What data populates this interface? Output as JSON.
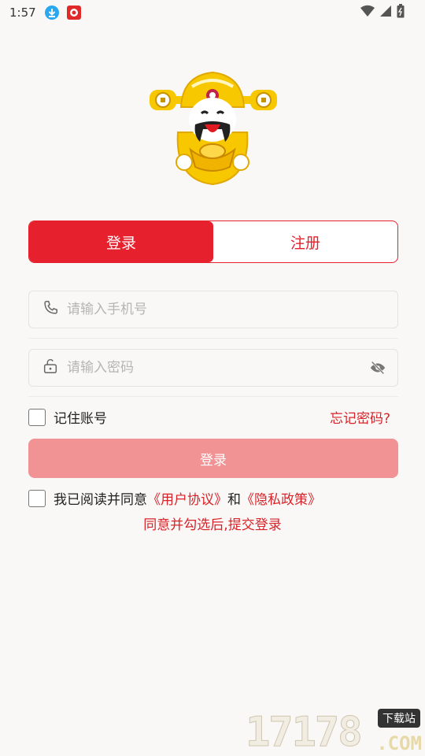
{
  "status_bar": {
    "time": "1:57"
  },
  "tabs": [
    {
      "label": "登录",
      "active": true
    },
    {
      "label": "注册",
      "active": false
    }
  ],
  "phone_field": {
    "placeholder": "请输入手机号",
    "value": ""
  },
  "password_field": {
    "placeholder": "请输入密码",
    "value": ""
  },
  "remember": {
    "label": "记住账号",
    "checked": false
  },
  "forgot_link": "忘记密码?",
  "login_button": "登录",
  "agreement": {
    "prefix": "我已阅读并同意",
    "user_agreement": "《用户协议》",
    "and": "和",
    "privacy_policy": "《隐私政策》",
    "checked": false
  },
  "hint": "同意并勾选后,提交登录",
  "watermark": {
    "number": "17178",
    "badge": "下载站",
    "suffix": ".COM"
  },
  "colors": {
    "accent": "#e6202c",
    "button_disabled": "#f19294",
    "link": "#d8232a"
  }
}
